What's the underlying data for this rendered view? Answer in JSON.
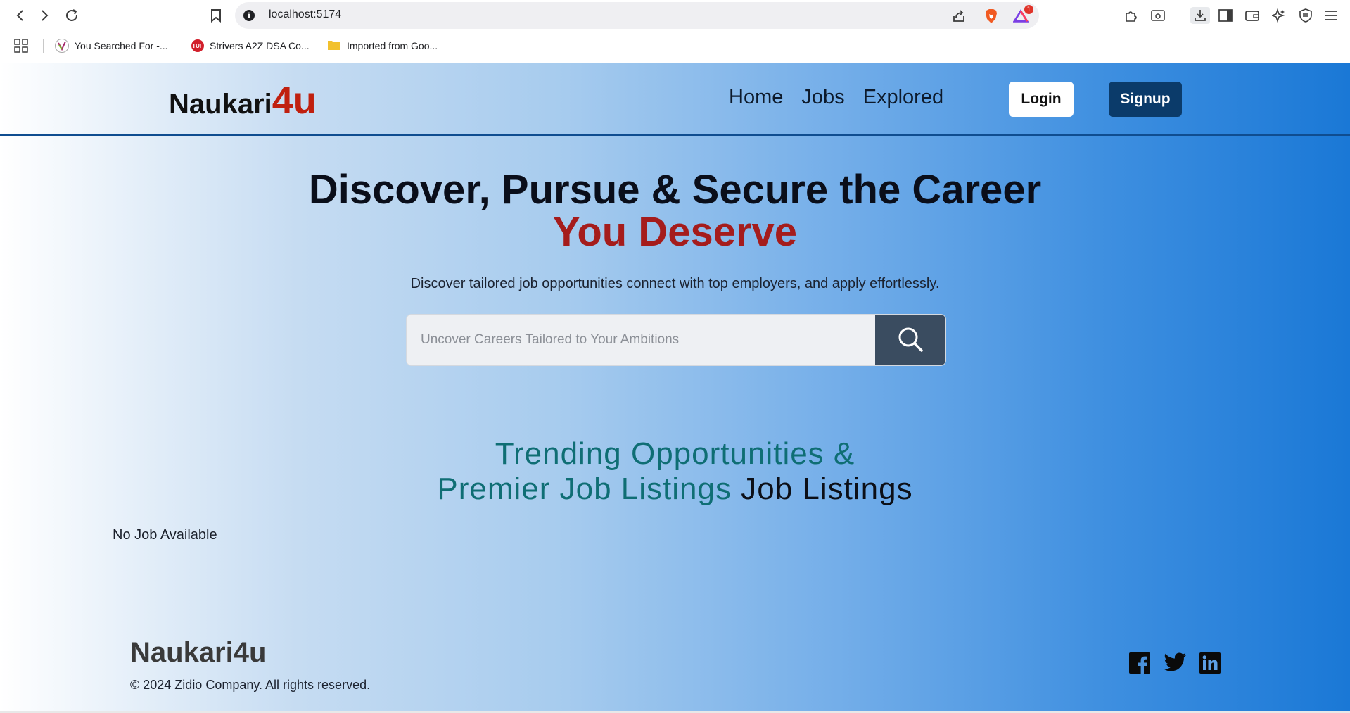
{
  "browser": {
    "url": "localhost:5174",
    "notification_count": "1",
    "bookmarks": [
      {
        "label": "You Searched For -...",
        "icon": "yoast-icon"
      },
      {
        "label": "Strivers A2Z DSA Co...",
        "icon": "tuf-icon",
        "icon_text": "TUF"
      },
      {
        "label": "Imported from Goo...",
        "icon": "folder-icon"
      }
    ]
  },
  "header": {
    "logo_base": "Naukari",
    "logo_accent": "4u",
    "nav": [
      "Home",
      "Jobs",
      "Explored"
    ],
    "login_label": "Login",
    "signup_label": "Signup"
  },
  "hero": {
    "title_line1": "Discover, Pursue & Secure the Career",
    "title_line2": "You Deserve",
    "subtitle": "Discover tailored job opportunities connect with top employers, and apply effortlessly.",
    "search_placeholder": "Uncover Careers Tailored to Your Ambitions"
  },
  "trending": {
    "line1": "Trending Opportunities &",
    "line2_teal": "Premier Job Listings",
    "line2_dark": "Job Listings"
  },
  "jobs": {
    "empty_message": "No Job Available"
  },
  "footer": {
    "logo": "Naukari4u",
    "copyright": "© 2024 Zidio Company. All rights reserved.",
    "social": [
      "facebook-icon",
      "twitter-icon",
      "linkedin-icon"
    ]
  },
  "colors": {
    "brand_red": "#c0200f",
    "title_red": "#a51c1c",
    "teal": "#0f6e74",
    "signup_bg": "#0b3b6a",
    "search_btn": "#3a4c60",
    "header_rule": "#0f4d90"
  }
}
